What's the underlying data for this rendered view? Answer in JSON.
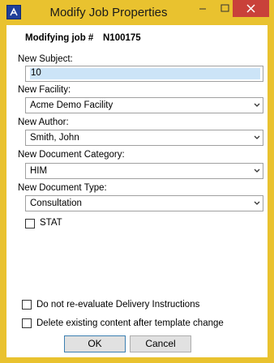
{
  "window": {
    "title": "Modify Job Properties"
  },
  "form": {
    "modifying_label": "Modifying job #",
    "job_number": "N100175",
    "subject_label": "New Subject:",
    "subject_value": "10",
    "facility_label": "New Facility:",
    "facility_value": "Acme Demo Facility",
    "author_label": "New Author:",
    "author_value": "Smith, John",
    "category_label": "New Document Category:",
    "category_value": "HIM",
    "type_label": "New Document Type:",
    "type_value": "Consultation",
    "stat_label": "STAT",
    "stat_checked": false,
    "no_reeval_label": "Do not re-evaluate Delivery Instructions",
    "no_reeval_checked": false,
    "delete_content_label": "Delete existing content after template change",
    "delete_content_checked": false
  },
  "buttons": {
    "ok": "OK",
    "cancel": "Cancel"
  },
  "colors": {
    "frame": "#e9c22f",
    "close": "#c9413a",
    "selection": "#cce4f7",
    "default_border": "#3c7fb1"
  },
  "icons": {
    "app": "app-icon",
    "minimize": "minimize-icon",
    "maximize": "maximize-icon",
    "close": "close-icon",
    "dropdown": "chevron-down-icon"
  }
}
